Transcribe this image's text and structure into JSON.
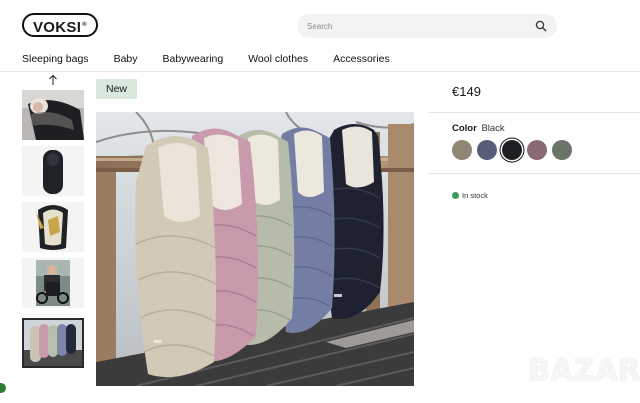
{
  "header": {
    "logo_text": "VOKSI",
    "logo_mark": "®",
    "search": {
      "placeholder": "Search",
      "icon": "search-icon"
    }
  },
  "nav": {
    "items": [
      {
        "label": "Sleeping bags"
      },
      {
        "label": "Baby"
      },
      {
        "label": "Babywearing"
      },
      {
        "label": "Wool clothes"
      },
      {
        "label": "Accessories"
      }
    ]
  },
  "gallery": {
    "scroll_up_icon": "arrow-up-icon",
    "badge": "New",
    "thumbnails": [
      {
        "name": "baby-in-black-bag"
      },
      {
        "name": "black-bag-front"
      },
      {
        "name": "cream-bag-open"
      },
      {
        "name": "stroller-with-bag"
      },
      {
        "name": "bags-lineup",
        "selected": true
      }
    ]
  },
  "product": {
    "price": "€149",
    "color_label": "Color",
    "color_value": "Black",
    "swatches": [
      {
        "name": "sand",
        "hex": "#8f8774"
      },
      {
        "name": "blue",
        "hex": "#585d77"
      },
      {
        "name": "black",
        "hex": "#1e2024",
        "selected": true
      },
      {
        "name": "mauve",
        "hex": "#8a6a72"
      },
      {
        "name": "sage",
        "hex": "#6b7469"
      }
    ],
    "stock_text": "In stock",
    "stock_color": "#3a9a5a"
  },
  "watermark": "BAZAR"
}
